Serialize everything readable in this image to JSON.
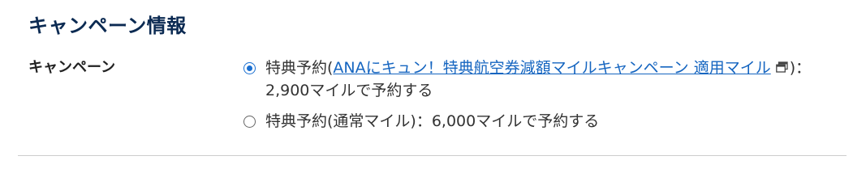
{
  "section": {
    "title": "キャンペーン情報"
  },
  "campaign": {
    "label": "キャンペーン",
    "options": [
      {
        "selected": true,
        "prefix": "特典予約(",
        "link_text": "ANAにキュン！特典航空券減額マイルキャンペーン 適用マイル",
        "link_icon": "new-window-icon",
        "suffix": ")：2,900マイルで予約する"
      },
      {
        "selected": false,
        "text": "特典予約(通常マイル)：6,000マイルで予約する"
      }
    ]
  },
  "colors": {
    "title": "#0b2a52",
    "link": "#1565c0",
    "radio_selected": "#1a6fd1",
    "divider": "#cccccc"
  }
}
